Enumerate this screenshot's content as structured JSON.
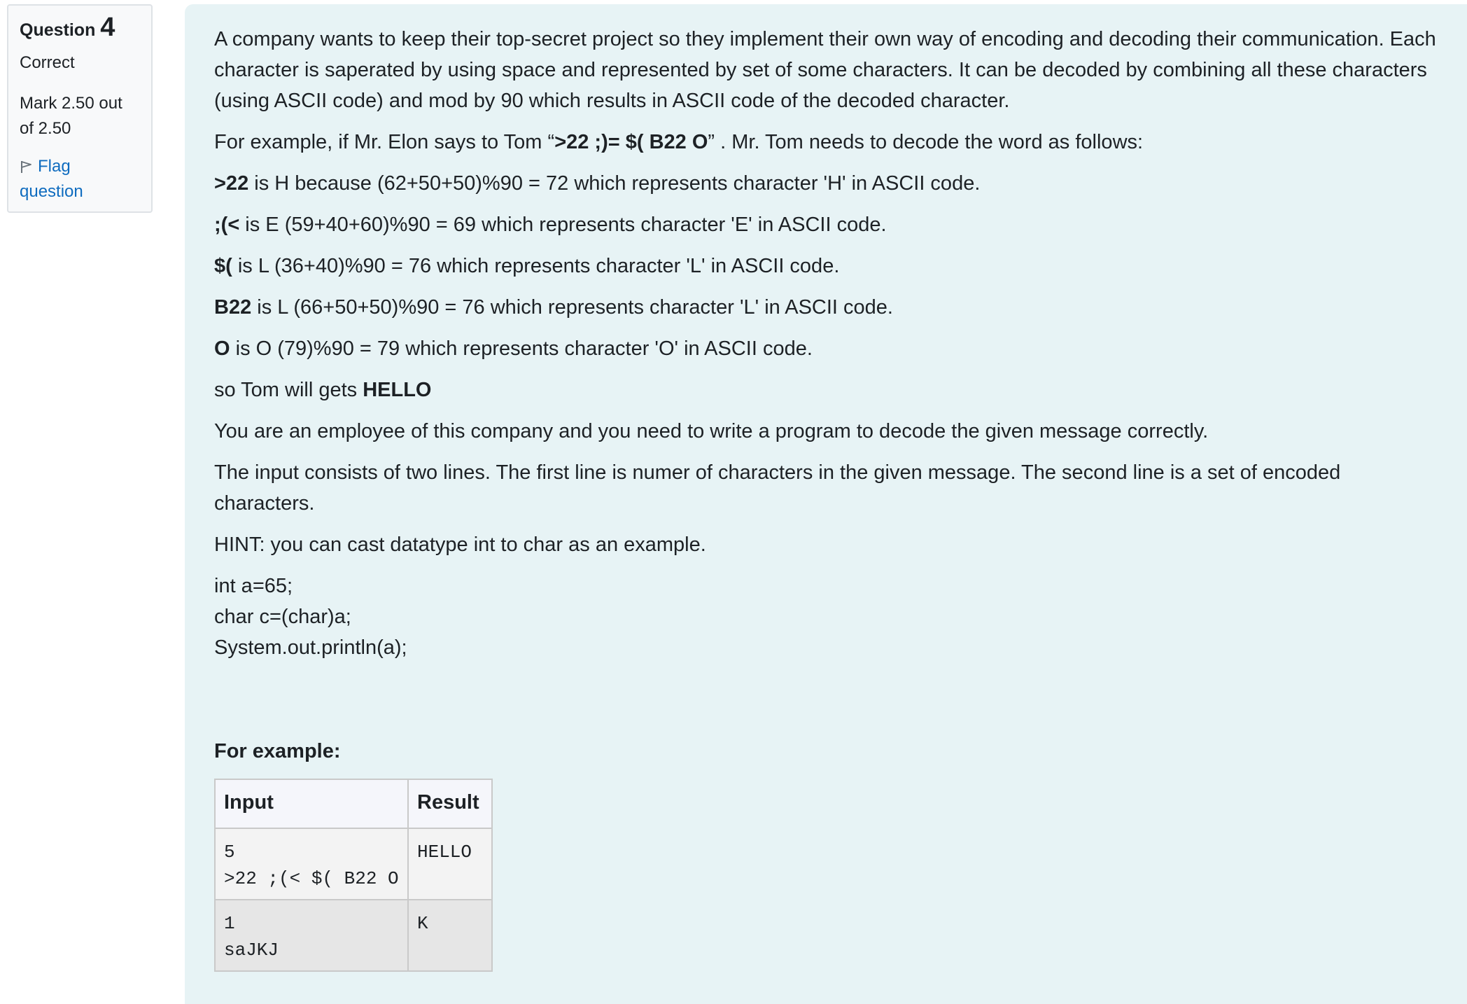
{
  "info": {
    "question_label": "Question",
    "question_number": "4",
    "state": "Correct",
    "grade_line1": "Mark 2.50 out",
    "grade_line2": "of 2.50",
    "flag_line1": "Flag",
    "flag_line2": "question"
  },
  "question": {
    "intro": "A company wants to keep their top-secret project so they implement their own way of encoding and decoding their communication. Each character is saperated by using space and represented by set of some characters. It can be decoded by combining all these characters (using ASCII code) and mod by 90 which results in ASCII code of the decoded character.",
    "example_pre": "For example, if Mr. Elon says to Tom “",
    "example_code": ">22 ;)= $( B22 O",
    "example_post": "” . Mr. Tom needs to decode the word as follows:",
    "lines": [
      {
        "bold": ">22",
        "text": " is H because (62+50+50)%90 = 72 which represents character 'H' in ASCII code."
      },
      {
        "bold": ";(<",
        "text": " is E (59+40+60)%90 = 69 which represents character 'E' in ASCII code."
      },
      {
        "bold": "$(",
        "text": " is L (36+40)%90 = 76 which represents character 'L' in ASCII code."
      },
      {
        "bold": "B22",
        "text": " is L (66+50+50)%90 = 76 which represents character 'L' in ASCII code."
      },
      {
        "bold": "O",
        "text": " is O (79)%90 = 79 which represents character 'O' in ASCII code."
      }
    ],
    "result_pre": "so Tom will gets ",
    "result_bold": "HELLO",
    "task": "You are an employee of this company and you need to write a program to decode the given message correctly.",
    "input_desc": "The input consists of two lines. The first line is numer of characters in the given message. The second line is a set of encoded characters.",
    "hint": "HINT: you can cast datatype int to char as an example.",
    "code": [
      "int a=65;",
      "char c=(char)a;",
      "System.out.println(a);"
    ]
  },
  "examples": {
    "heading": "For example:",
    "col_input": "Input",
    "col_result": "Result",
    "rows": [
      {
        "input": "5\n>22 ;(< $( B22 O",
        "result": "HELLO"
      },
      {
        "input": "1\nsaJKJ",
        "result": "K"
      }
    ]
  }
}
